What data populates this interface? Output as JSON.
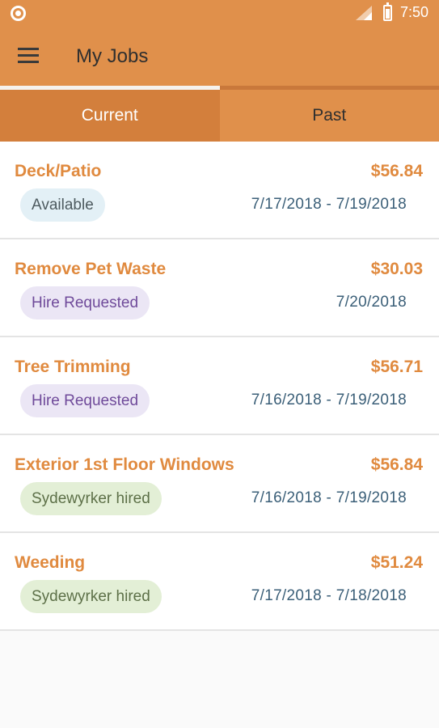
{
  "status_bar": {
    "time": "7:50",
    "icons": [
      "record-icon",
      "signal-icon",
      "battery-icon"
    ]
  },
  "app_bar": {
    "menu_icon": "menu-icon",
    "title": "My Jobs"
  },
  "tabs": [
    {
      "label": "Current",
      "active": true
    },
    {
      "label": "Past",
      "active": false
    }
  ],
  "jobs": [
    {
      "title": "Deck/Patio",
      "price": "$56.84",
      "status": "Available",
      "status_type": "available",
      "dates": "7/17/2018 - 7/19/2018"
    },
    {
      "title": "Remove Pet Waste",
      "price": "$30.03",
      "status": "Hire Requested",
      "status_type": "hire",
      "dates": "7/20/2018"
    },
    {
      "title": "Tree Trimming",
      "price": "$56.71",
      "status": "Hire Requested",
      "status_type": "hire",
      "dates": "7/16/2018 - 7/19/2018"
    },
    {
      "title": "Exterior 1st Floor Windows",
      "price": "$56.84",
      "status": "Sydewyrker hired",
      "status_type": "hired",
      "dates": "7/16/2018 - 7/19/2018"
    },
    {
      "title": "Weeding",
      "price": "$51.24",
      "status": "Sydewyrker hired",
      "status_type": "hired",
      "dates": "7/17/2018 - 7/18/2018"
    }
  ],
  "colors": {
    "primary": "#e0904b",
    "accent_text": "#e08a3f",
    "date_text": "#3b5f78"
  }
}
